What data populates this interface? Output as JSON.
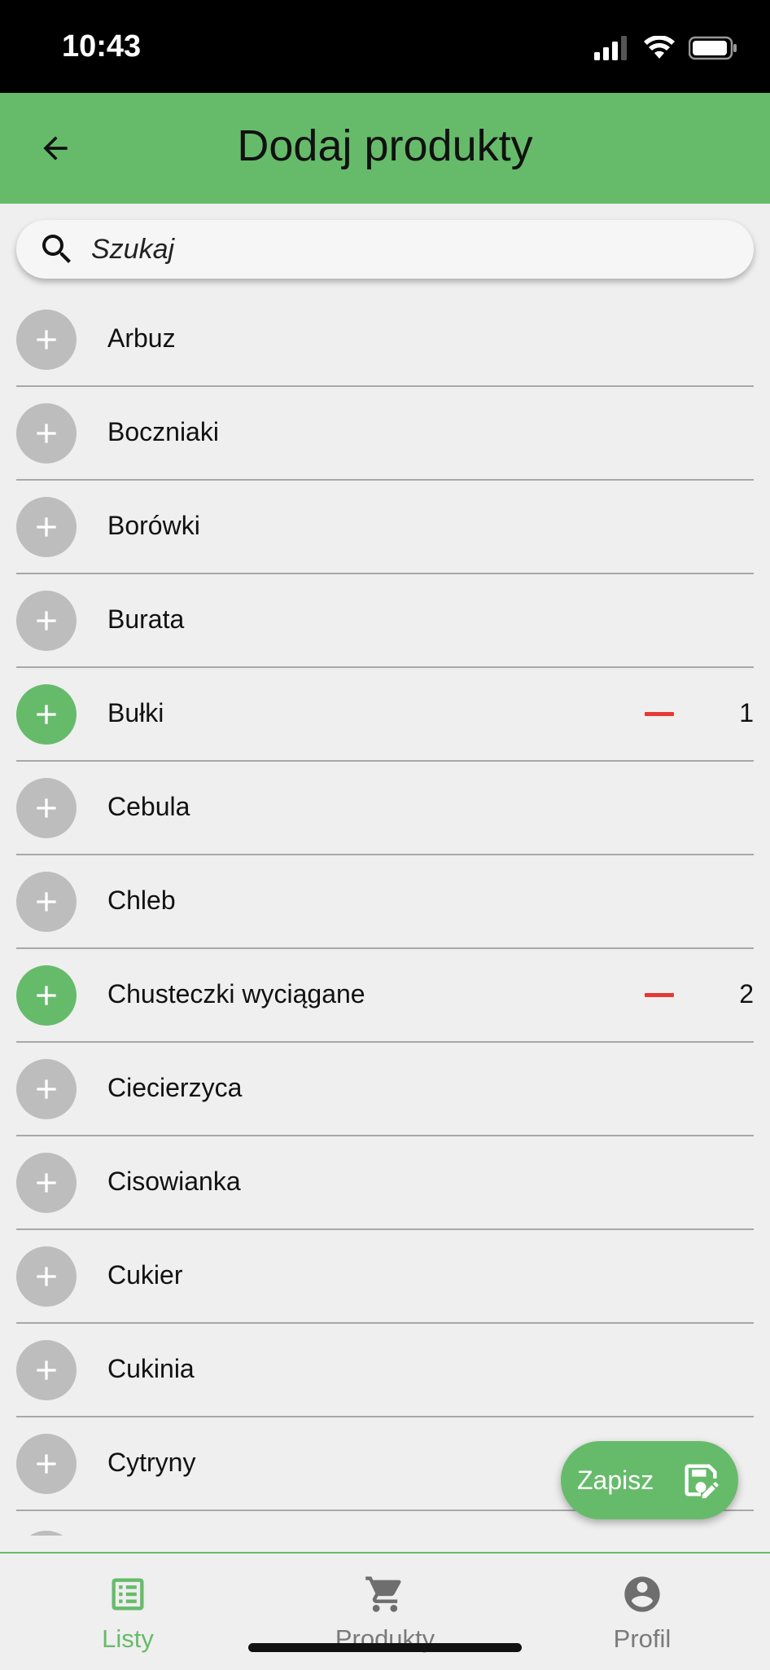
{
  "status_bar": {
    "time": "10:43"
  },
  "header": {
    "title": "Dodaj produkty"
  },
  "search": {
    "placeholder": "Szukaj"
  },
  "products": [
    {
      "name": "Arbuz",
      "selected": false,
      "quantity": ""
    },
    {
      "name": "Boczniaki",
      "selected": false,
      "quantity": ""
    },
    {
      "name": "Borówki",
      "selected": false,
      "quantity": ""
    },
    {
      "name": "Burata",
      "selected": false,
      "quantity": ""
    },
    {
      "name": "Bułki",
      "selected": true,
      "quantity": "1"
    },
    {
      "name": "Cebula",
      "selected": false,
      "quantity": ""
    },
    {
      "name": "Chleb",
      "selected": false,
      "quantity": ""
    },
    {
      "name": "Chusteczki wyciągane",
      "selected": true,
      "quantity": "2"
    },
    {
      "name": "Ciecierzyca",
      "selected": false,
      "quantity": ""
    },
    {
      "name": "Cisowianka",
      "selected": false,
      "quantity": ""
    },
    {
      "name": "Cukier",
      "selected": false,
      "quantity": ""
    },
    {
      "name": "Cukinia",
      "selected": false,
      "quantity": ""
    },
    {
      "name": "Cytryny",
      "selected": false,
      "quantity": ""
    }
  ],
  "fab": {
    "label": "Zapisz",
    "icon": "save-edit-icon"
  },
  "bottom_nav": [
    {
      "label": "Listy",
      "icon": "list-icon",
      "active": true
    },
    {
      "label": "Produkty",
      "icon": "cart-icon",
      "active": false
    },
    {
      "label": "Profil",
      "icon": "account-circle-icon",
      "active": false
    }
  ],
  "colors": {
    "primary": "#66bb6a",
    "inactive": "#bdbdbd",
    "remove": "#e53935",
    "background": "#efefef"
  }
}
